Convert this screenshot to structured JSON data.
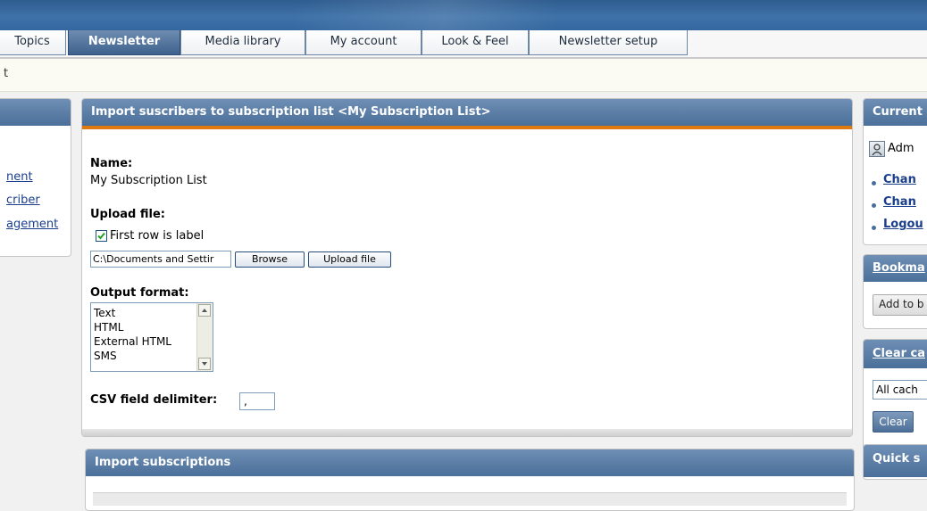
{
  "tabs": [
    {
      "label": "Topics",
      "active": false
    },
    {
      "label": "Newsletter",
      "active": true
    },
    {
      "label": "Media library",
      "active": false
    },
    {
      "label": "My account",
      "active": false
    },
    {
      "label": "Look & Feel",
      "active": false
    },
    {
      "label": "Newsletter setup",
      "active": false
    }
  ],
  "breadcrumb": "t",
  "left_menu": {
    "links": [
      "nent",
      "criber",
      "agement"
    ]
  },
  "import_panel": {
    "title": "Import suscribers to subscription list <My Subscription List>",
    "name_label": "Name:",
    "name_value": "My Subscription List",
    "upload_label": "Upload file:",
    "first_row_label": "First row is label",
    "first_row_checked": true,
    "file_path": "C:\\Documents and Settir",
    "browse_button": "Browse",
    "upload_button": "Upload file",
    "output_label": "Output format:",
    "output_options": [
      "Text",
      "HTML",
      "External HTML",
      "SMS"
    ],
    "csv_label": "CSV field delimiter:",
    "csv_value": ","
  },
  "import_subscriptions_panel": {
    "title": "Import subscriptions"
  },
  "right_sidebar": {
    "current_title": "Current",
    "user_name": "Adm",
    "links": [
      "Chan",
      "Chan",
      "Logou"
    ],
    "bookmarks_title": "Bookma",
    "add_bookmark_button": "Add to b",
    "clear_cache_title": "Clear ca",
    "cache_select": "All cach",
    "clear_button": "Clear",
    "quick_title": "Quick s"
  },
  "colors": {
    "header_blue": "#4a6f99",
    "accent_orange": "#e07a10",
    "link_blue": "#1a3e8c"
  },
  "icons": {
    "user": "user-icon",
    "checkbox": "checkbox-checked-icon",
    "scroll_up": "scroll-up-arrow-icon",
    "scroll_down": "scroll-down-arrow-icon"
  }
}
